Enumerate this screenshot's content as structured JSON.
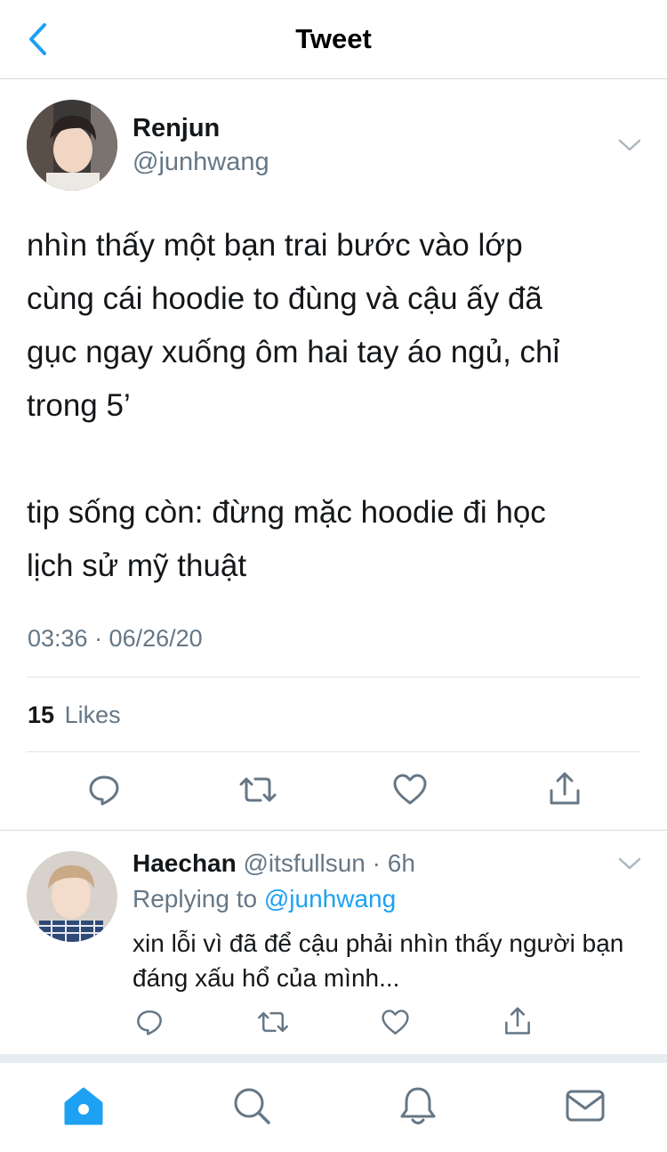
{
  "header": {
    "title": "Tweet"
  },
  "tweet": {
    "author_name": "Renjun",
    "author_handle": "@junhwang",
    "text": "nhìn thấy một bạn trai bước vào lớp\ncùng cái hoodie to đùng và cậu ấy đã\ngục ngay xuống ôm hai tay áo ngủ, chỉ\ntrong 5’\n\ntip sống còn: đừng mặc hoodie đi học\nlịch sử mỹ thuật",
    "timestamp": "03:36 · 06/26/20",
    "likes_count": "15",
    "likes_label": "Likes"
  },
  "reply": {
    "author_name": "Haechan",
    "author_handle": "@itsfullsun",
    "time": "· 6h",
    "replying_prefix": "Replying to",
    "replying_to": "@junhwang",
    "text": "xin lỗi vì đã để cậu phải nhìn thấy người bạn đáng xấu hổ của mình..."
  },
  "colors": {
    "accent": "#1da1f2",
    "secondary_text": "#657786",
    "icon_gray": "#657786"
  },
  "icons": {
    "back": "chevron-left-icon",
    "menu": "chevron-down-icon",
    "actions": [
      "reply-icon",
      "retweet-icon",
      "like-icon",
      "share-icon"
    ],
    "tabs": [
      "home-icon",
      "search-icon",
      "notifications-icon",
      "messages-icon"
    ]
  }
}
